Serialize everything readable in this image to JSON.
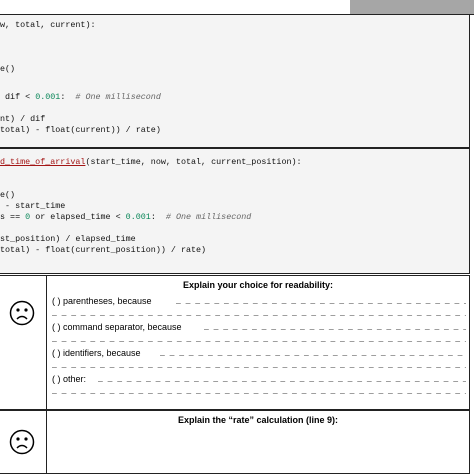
{
  "code_block_1": {
    "lines": [
      "",
      "w, total, current):",
      "",
      "",
      "e()",
      "",
      " dif < 0.001:  # One millisecond",
      "",
      "nt) / dif",
      "total) - float(current)) / rate)"
    ]
  },
  "code_block_2": {
    "function_name": "d_time_of_arrival",
    "signature_rest": "(start_time, now, total, current_position):",
    "lines": [
      "",
      "e()",
      " - start_time",
      "s == 0 or elapsed_time < 0.001:  # One millisecond",
      "",
      "st_position) / elapsed_time",
      "total) - float(current_position)) / rate)"
    ]
  },
  "question_1": {
    "heading": "Explain your choice for readability:",
    "options": [
      "(  ) parentheses, because",
      "(  ) command separator, because",
      "(  ) identifiers, because",
      "(  ) other:"
    ]
  },
  "question_2": {
    "heading": "Explain the “rate” calculation (line 9):"
  },
  "icons": {
    "face": "sad-face-icon"
  },
  "colors": {
    "code_background": "#f4f4f4",
    "function_name": "#a31515",
    "number": "#098658",
    "comment": "#666666",
    "header_grey": "#a6a6a6"
  }
}
